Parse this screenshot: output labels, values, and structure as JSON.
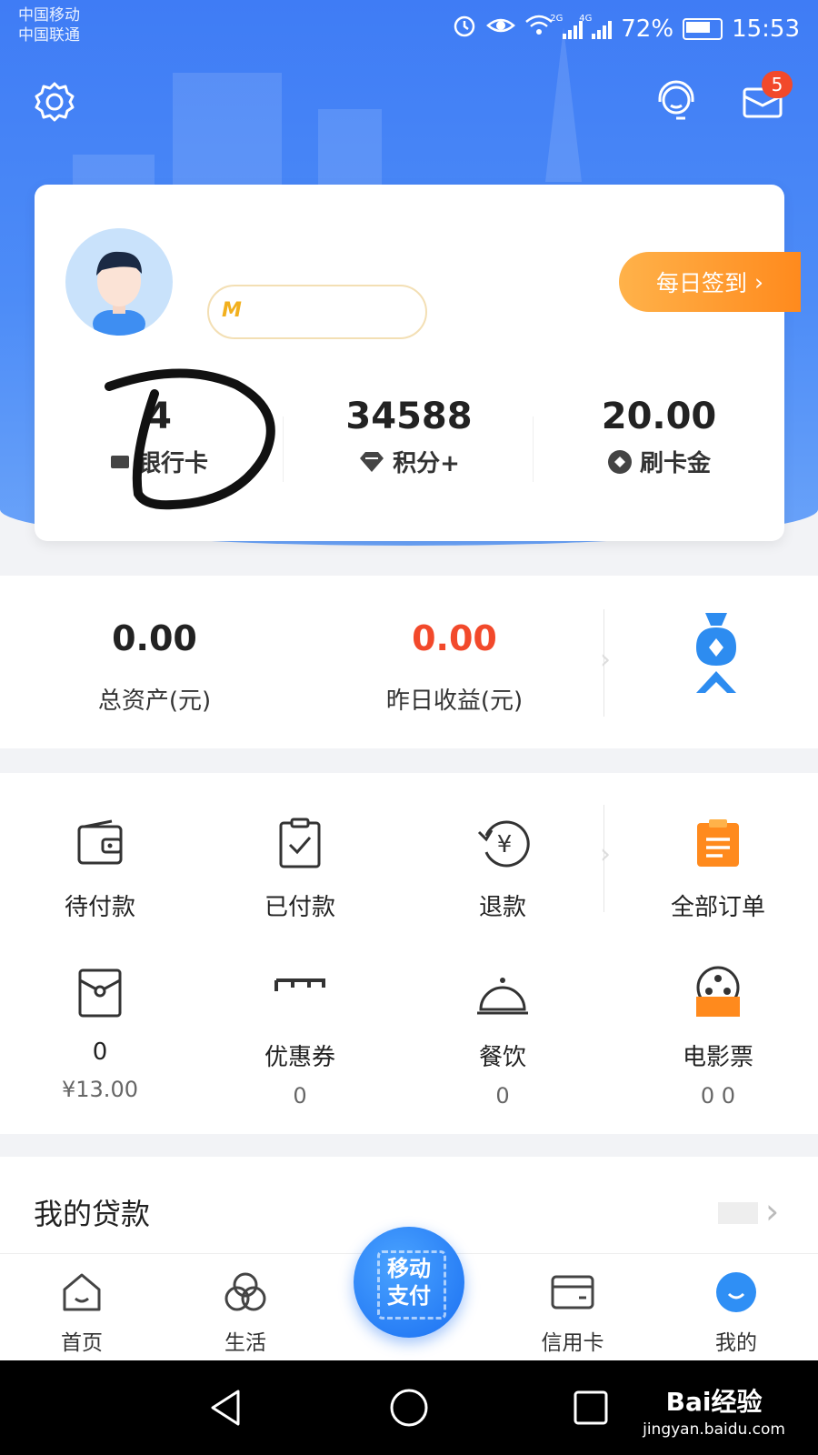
{
  "status_bar": {
    "carrier1": "中国移动",
    "carrier2": "中国联通",
    "net1": "2G",
    "net2": "4G",
    "battery": "72%",
    "time": "15:53"
  },
  "header": {
    "mail_badge": "5"
  },
  "profile": {
    "level_text": "M",
    "checkin_label": "每日签到",
    "stats": [
      {
        "value": "4",
        "label": "银行卡"
      },
      {
        "value": "34588",
        "label": "积分+"
      },
      {
        "value": "20.00",
        "label": "刷卡金"
      }
    ]
  },
  "assets": {
    "total_value": "0.00",
    "total_label": "总资产(元)",
    "yesterday_value": "0.00",
    "yesterday_label": "昨日收益(元)",
    "yesterday_color": "#f2492b"
  },
  "orders": {
    "items": [
      {
        "label": "待付款"
      },
      {
        "label": "已付款"
      },
      {
        "label": "退款"
      },
      {
        "label": "全部订单"
      }
    ],
    "row2": [
      {
        "label": "0",
        "sub": "¥13.00"
      },
      {
        "label": "优惠券",
        "sub": "0"
      },
      {
        "label": "餐饮",
        "sub": "0"
      },
      {
        "label": "电影票",
        "sub": "0   0"
      }
    ]
  },
  "loans": {
    "title": "我的贷款"
  },
  "tabbar": {
    "tabs": [
      {
        "label": "首页"
      },
      {
        "label": "生活"
      },
      {
        "label": "信用卡"
      },
      {
        "label": "我的"
      }
    ],
    "pay_label_line1": "移动",
    "pay_label_line2": "支付"
  },
  "watermark": {
    "brand": "Bai经验",
    "url": "jingyan.baidu.com"
  },
  "colors": {
    "primary": "#3f7cf5",
    "orange": "#ff8a1d",
    "red": "#f2492b"
  }
}
